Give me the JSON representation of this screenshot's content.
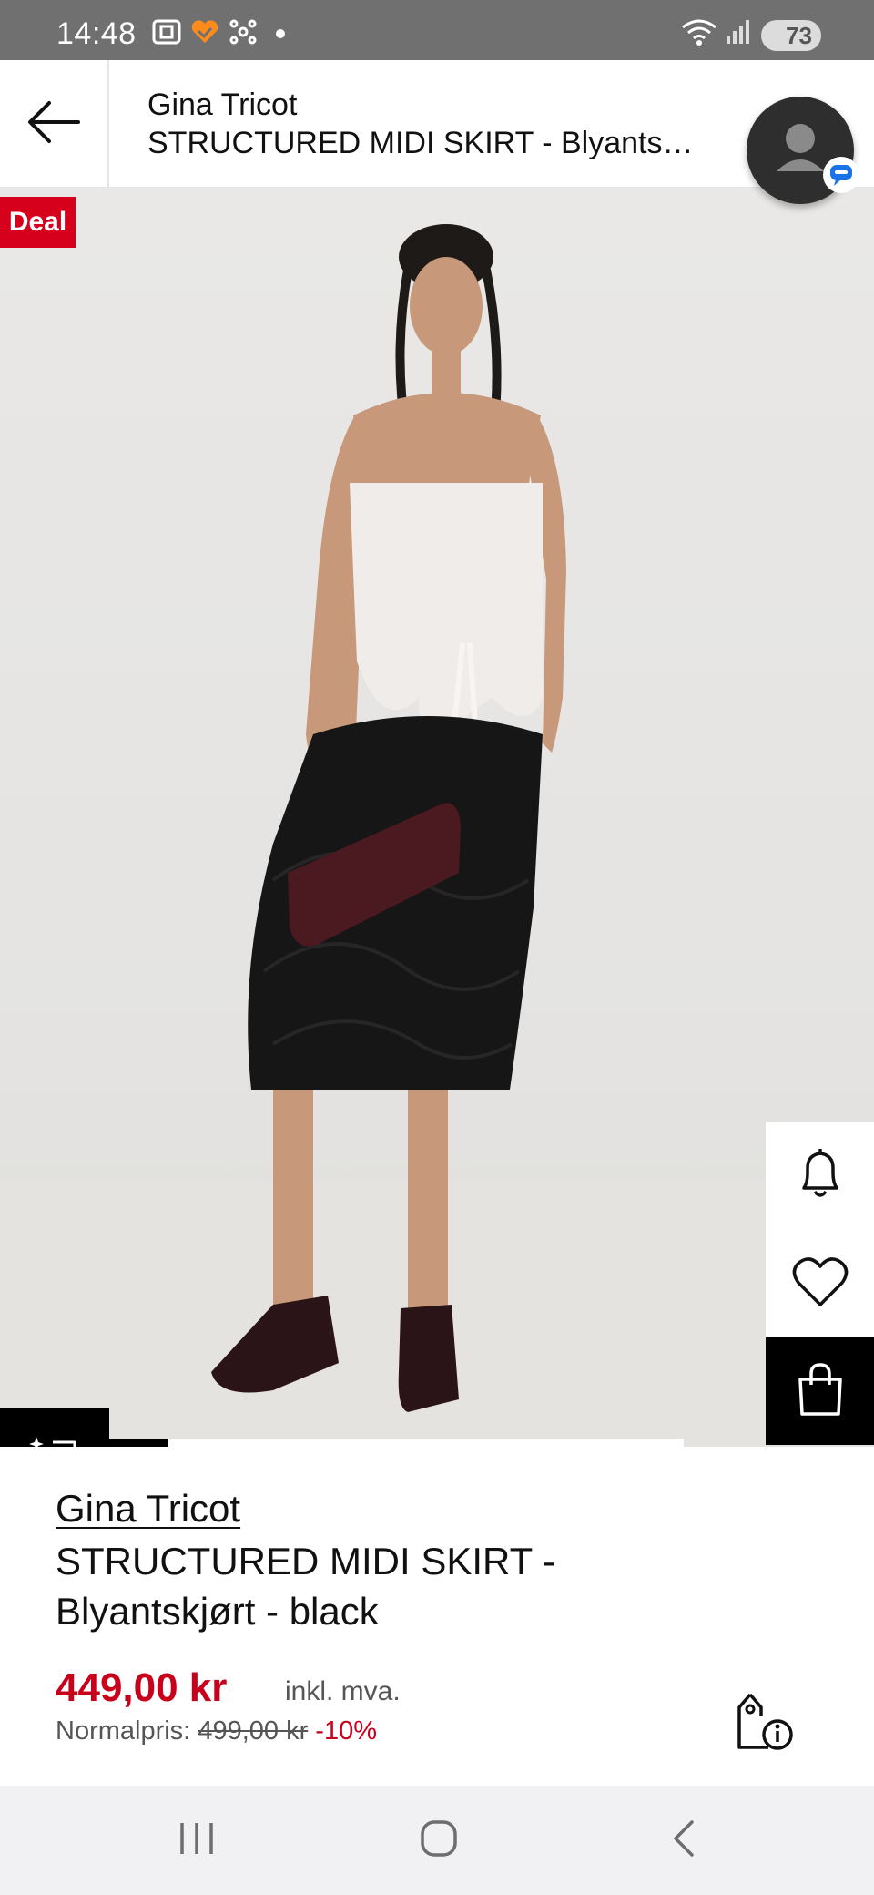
{
  "status_bar": {
    "time": "14:48",
    "battery": "73",
    "icons": [
      "screenshot-icon",
      "app-heart-icon",
      "network-icon",
      "dot-icon",
      "wifi-icon",
      "signal-icon",
      "battery-icon"
    ]
  },
  "header": {
    "back_icon": "arrow-left-icon",
    "brand": "Gina Tricot",
    "title": "STRUCTURED MIDI SKIRT - Blyants…"
  },
  "image": {
    "badge": "Deal",
    "carousel_progress": 0.14
  },
  "side_actions": [
    "bell-icon",
    "heart-icon",
    "shopping-bag-icon"
  ],
  "ai_button_icon": "sparkle-chat-icon",
  "product": {
    "brand": "Gina Tricot",
    "name": "STRUCTURED MIDI SKIRT - Blyantskjørt - black",
    "price": "449,00 kr",
    "vat_label": "inkl. mva.",
    "normal_label": "Normalpris:",
    "normal_price": "499,00 kr",
    "discount": "-10%",
    "price_info_icon": "price-tag-info-icon"
  },
  "colors": {
    "accent_red": "#d6001c",
    "price_red": "#c8001b",
    "status_bar": "#707070"
  },
  "nav": [
    "recent-apps-icon",
    "home-icon",
    "back-icon"
  ]
}
